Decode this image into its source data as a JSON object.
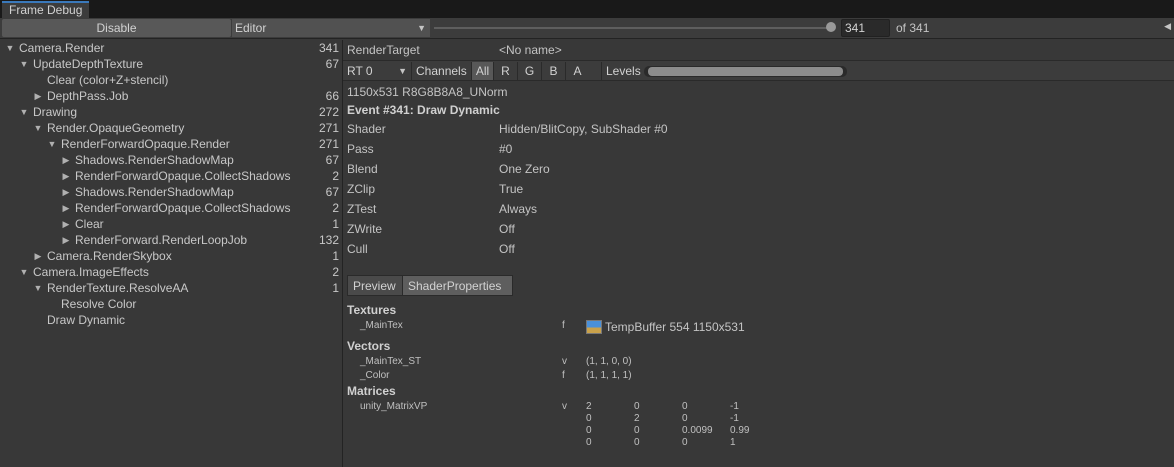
{
  "window_tab": "Frame Debug",
  "toolbar": {
    "disable_label": "Disable",
    "target_value": "Editor",
    "frame_value": "341",
    "frame_total": "of 341"
  },
  "tree": [
    {
      "label": "Camera.Render",
      "count": "341",
      "expanded": true,
      "has_children": true
    },
    {
      "label": "UpdateDepthTexture",
      "count": "67",
      "expanded": true,
      "has_children": true
    },
    {
      "label": "Clear (color+Z+stencil)",
      "count": "",
      "expanded": false,
      "has_children": false
    },
    {
      "label": "DepthPass.Job",
      "count": "66",
      "expanded": false,
      "has_children": true
    },
    {
      "label": "Drawing",
      "count": "272",
      "expanded": true,
      "has_children": true
    },
    {
      "label": "Render.OpaqueGeometry",
      "count": "271",
      "expanded": true,
      "has_children": true
    },
    {
      "label": "RenderForwardOpaque.Render",
      "count": "271",
      "expanded": true,
      "has_children": true
    },
    {
      "label": "Shadows.RenderShadowMap",
      "count": "67",
      "expanded": false,
      "has_children": true
    },
    {
      "label": "RenderForwardOpaque.CollectShadows",
      "count": "2",
      "expanded": false,
      "has_children": true
    },
    {
      "label": "Shadows.RenderShadowMap",
      "count": "67",
      "expanded": false,
      "has_children": true
    },
    {
      "label": "RenderForwardOpaque.CollectShadows",
      "count": "2",
      "expanded": false,
      "has_children": true
    },
    {
      "label": "Clear",
      "count": "1",
      "expanded": false,
      "has_children": true
    },
    {
      "label": "RenderForward.RenderLoopJob",
      "count": "132",
      "expanded": false,
      "has_children": true
    },
    {
      "label": "Camera.RenderSkybox",
      "count": "1",
      "expanded": false,
      "has_children": true
    },
    {
      "label": "Camera.ImageEffects",
      "count": "2",
      "expanded": true,
      "has_children": true
    },
    {
      "label": "RenderTexture.ResolveAA",
      "count": "1",
      "expanded": true,
      "has_children": true
    },
    {
      "label": "Resolve Color",
      "count": "",
      "expanded": false,
      "has_children": false
    },
    {
      "label": "Draw Dynamic",
      "count": "",
      "expanded": false,
      "has_children": false
    }
  ],
  "details": {
    "render_target_label": "RenderTarget",
    "render_target_value": "<No name>",
    "rt_select": "RT 0",
    "channels_label": "Channels",
    "channels": [
      "All",
      "R",
      "G",
      "B",
      "A"
    ],
    "levels_label": "Levels",
    "format": "1150x531 R8G8B8A8_UNorm",
    "event_title": "Event #341: Draw Dynamic",
    "props": [
      {
        "name": "Shader",
        "value": "Hidden/BlitCopy, SubShader #0"
      },
      {
        "name": "Pass",
        "value": "#0"
      },
      {
        "name": "Blend",
        "value": "One Zero"
      },
      {
        "name": "ZClip",
        "value": "True"
      },
      {
        "name": "ZTest",
        "value": "Always"
      },
      {
        "name": "ZWrite",
        "value": "Off"
      },
      {
        "name": "Cull",
        "value": "Off"
      }
    ],
    "tabs": [
      "Preview",
      "ShaderProperties"
    ],
    "textures_header": "Textures",
    "texture": {
      "name": "_MainTex",
      "type": "f",
      "value": "TempBuffer 554 1150x531"
    },
    "vectors_header": "Vectors",
    "vectors": [
      {
        "name": "_MainTex_ST",
        "type": "v",
        "value": "(1, 1, 0, 0)"
      },
      {
        "name": "_Color",
        "type": "f",
        "value": "(1, 1, 1, 1)"
      }
    ],
    "matrices_header": "Matrices",
    "matrix": {
      "name": "unity_MatrixVP",
      "type": "v",
      "rows": [
        [
          "2",
          "0",
          "0",
          "-1"
        ],
        [
          "0",
          "2",
          "0",
          "-1"
        ],
        [
          "0",
          "0",
          "0.0099",
          "0.99"
        ],
        [
          "0",
          "0",
          "0",
          "1"
        ]
      ]
    }
  }
}
